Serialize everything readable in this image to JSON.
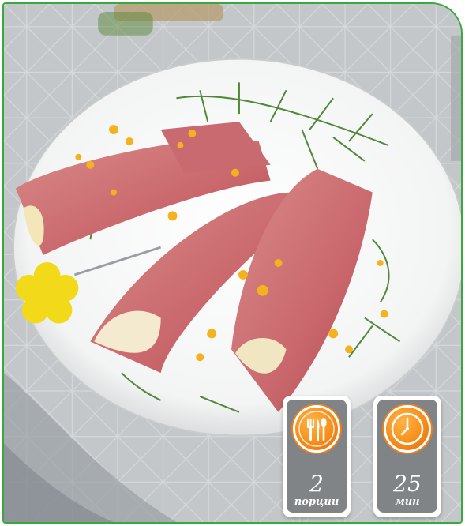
{
  "badges": {
    "servings": {
      "value": "2",
      "unit": "порции",
      "icon": "fork-knife-spoon-icon",
      "color": "#f7931e"
    },
    "time": {
      "value": "25",
      "unit": "мин",
      "icon": "clock-icon",
      "color": "#f7931e"
    }
  },
  "frame_color": "#3aa83f"
}
